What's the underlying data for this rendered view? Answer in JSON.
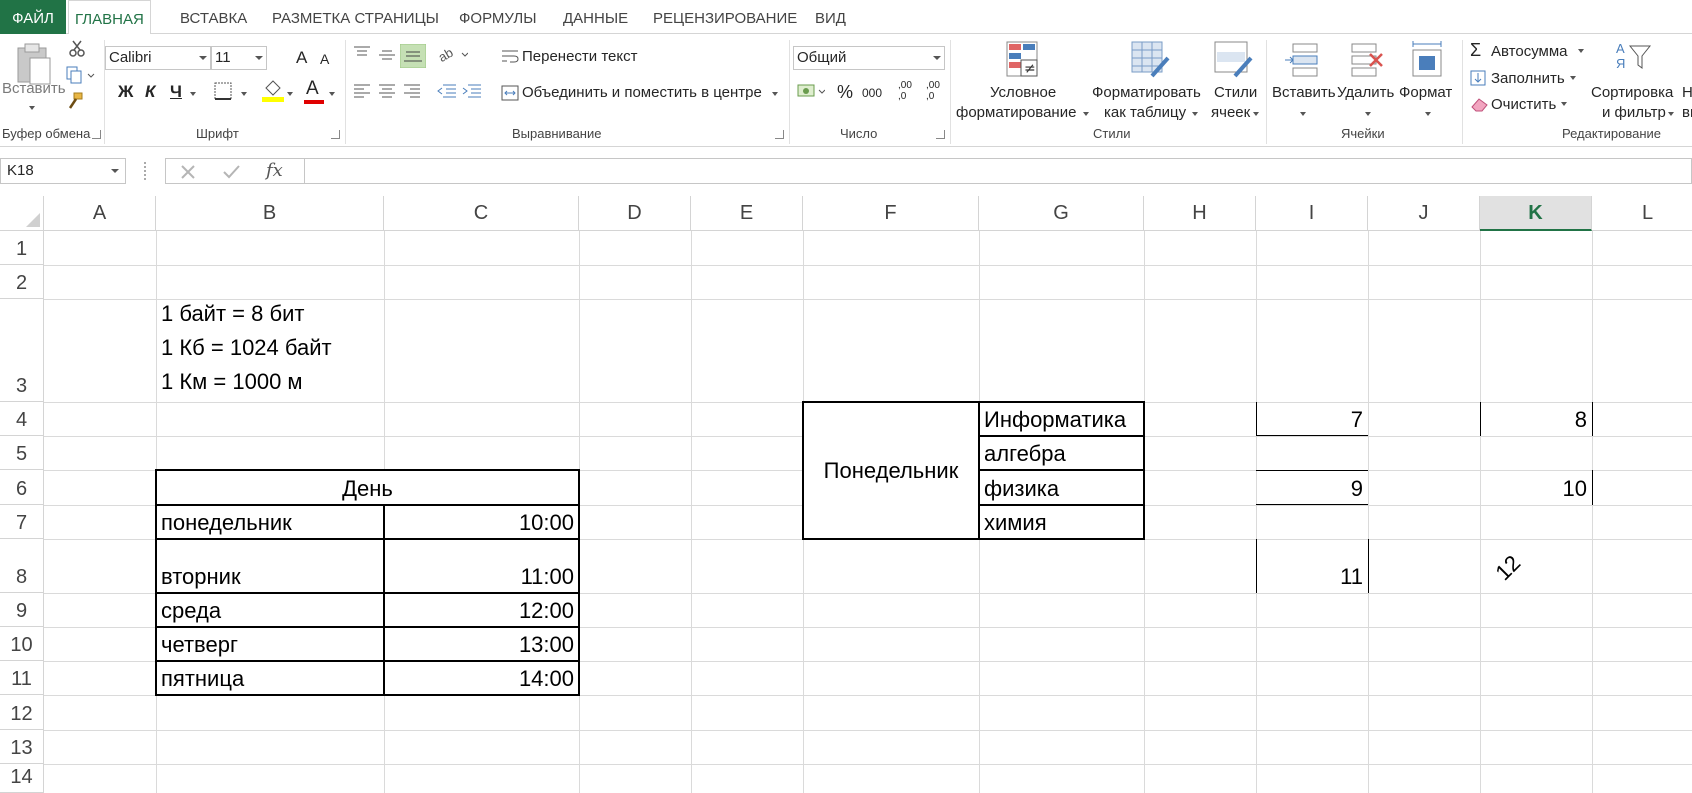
{
  "tabs": [
    "ФАЙЛ",
    "ГЛАВНАЯ",
    "ВСТАВКА",
    "РАЗМЕТКА СТРАНИЦЫ",
    "ФОРМУЛЫ",
    "ДАННЫЕ",
    "РЕЦЕНЗИРОВАНИЕ",
    "ВИД"
  ],
  "active_tab": "ГЛАВНАЯ",
  "accent_color": "#217346",
  "ribbon": {
    "clipboard": {
      "paste_label": "Вставить",
      "group_label": "Буфер обмена"
    },
    "font": {
      "font_name": "Calibri",
      "font_size": "11",
      "bold": "Ж",
      "italic": "К",
      "underline": "Ч",
      "grow": "A",
      "shrink": "A",
      "font_color_letter": "A",
      "group_label": "Шрифт"
    },
    "alignment": {
      "wrap_text": "Перенести текст",
      "merge_center": "Объединить и поместить в центре",
      "group_label": "Выравнивание"
    },
    "number": {
      "format": "Общий",
      "percent": "%",
      "thousands": "000",
      "inc_decimal": ",00 ,0",
      "dec_decimal": ",00 ,0",
      "group_label": "Число"
    },
    "styles": {
      "conditional_1": "Условное",
      "conditional_2": "форматирование",
      "format_table_1": "Форматировать",
      "format_table_2": "как таблицу",
      "cell_styles_1": "Стили",
      "cell_styles_2": "ячеек",
      "group_label": "Стили"
    },
    "cells": {
      "insert": "Вставить",
      "delete": "Удалить",
      "format": "Формат",
      "group_label": "Ячейки"
    },
    "editing": {
      "autosum": "Автосумма",
      "fill": "Заполнить",
      "clear": "Очистить",
      "sort_1": "Сортировка",
      "sort_2": "и фильтр",
      "find_1": "Н",
      "find_2": "вь",
      "group_label": "Редактирование"
    }
  },
  "formula_bar": {
    "name_box": "K18",
    "fx": "fx",
    "formula": ""
  },
  "columns": [
    "A",
    "B",
    "C",
    "D",
    "E",
    "F",
    "G",
    "H",
    "I",
    "J",
    "K",
    "L"
  ],
  "selected_column": "K",
  "rows": [
    "1",
    "2",
    "3",
    "4",
    "5",
    "6",
    "7",
    "8",
    "9",
    "10",
    "11",
    "12",
    "13",
    "14"
  ],
  "cells": {
    "b3_line1": "1 байт = 8 бит",
    "b3_line2": "1 Кб = 1024 байт",
    "b3_line3": "1 Км = 1000 м",
    "b6": "День",
    "b7": "понедельник",
    "c7": "10:00",
    "b8": "вторник",
    "c8": "11:00",
    "b9": "среда",
    "c9": "12:00",
    "b10": "четверг",
    "c10": "13:00",
    "b11": "пятница",
    "c11": "14:00",
    "f4_7": "Понедельник",
    "g4": "Информатика",
    "g5": "алгебра",
    "g6": "физика",
    "g7": "химия",
    "i4": "7",
    "k4": "8",
    "i6": "9",
    "k6": "10",
    "i8": "11",
    "k8": "12"
  }
}
